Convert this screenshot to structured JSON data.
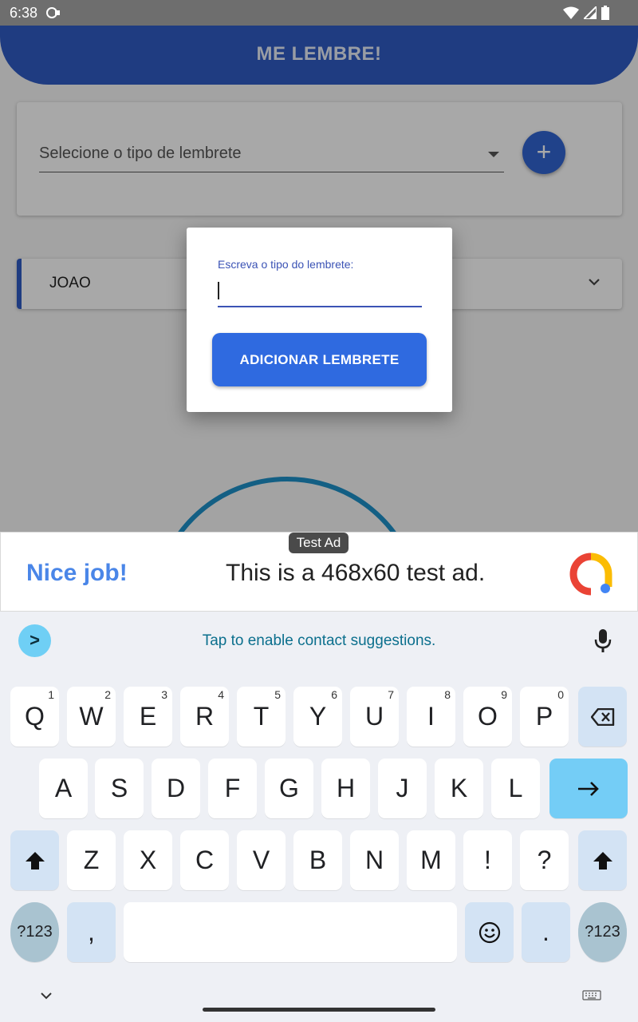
{
  "status_bar": {
    "time": "6:38"
  },
  "app": {
    "title": "ME LEMBRE!",
    "select_placeholder": "Selecione o tipo de lembrete",
    "fab_label": "+",
    "reminder_item": "JOAO"
  },
  "dialog": {
    "field_label": "Escreva o tipo do lembrete:",
    "field_value": "",
    "button_label": "ADICIONAR LEMBRETE"
  },
  "ad": {
    "badge": "Test Ad",
    "headline": "Nice job!",
    "text": "This is a 468x60 test ad."
  },
  "keyboard": {
    "suggestion": "Tap to enable contact suggestions.",
    "suggestion_arrow": ">",
    "row1": [
      {
        "key": "Q",
        "num": "1"
      },
      {
        "key": "W",
        "num": "2"
      },
      {
        "key": "E",
        "num": "3"
      },
      {
        "key": "R",
        "num": "4"
      },
      {
        "key": "T",
        "num": "5"
      },
      {
        "key": "Y",
        "num": "6"
      },
      {
        "key": "U",
        "num": "7"
      },
      {
        "key": "I",
        "num": "8"
      },
      {
        "key": "O",
        "num": "9"
      },
      {
        "key": "P",
        "num": "0"
      }
    ],
    "row2": [
      "A",
      "S",
      "D",
      "F",
      "G",
      "H",
      "J",
      "K",
      "L"
    ],
    "row3": [
      "Z",
      "X",
      "C",
      "V",
      "B",
      "N",
      "M",
      "!",
      "?"
    ],
    "symbols_label": "?123",
    "comma": ",",
    "period": "."
  },
  "colors": {
    "primary": "#2f5bc4",
    "button": "#2f6ae0",
    "ad_headline": "#4a86e8",
    "keyboard_accent": "#74cdf6"
  }
}
